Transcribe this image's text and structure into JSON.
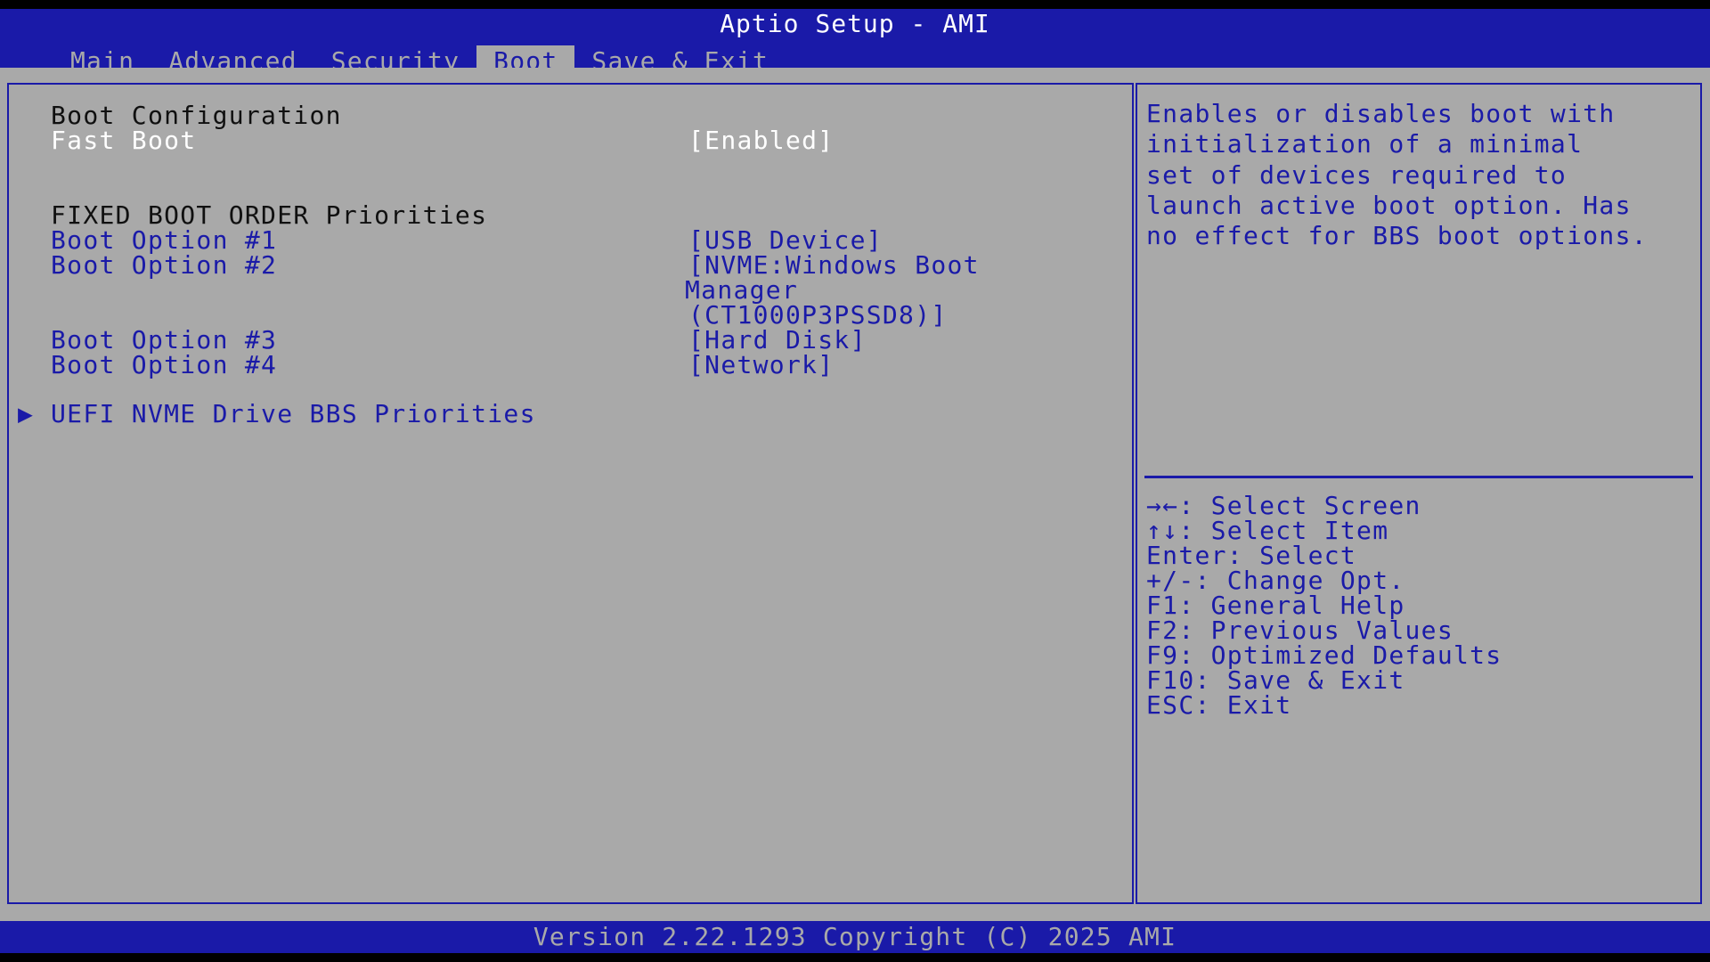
{
  "app": {
    "title": "Aptio Setup - AMI"
  },
  "tabs": [
    {
      "label": "Main"
    },
    {
      "label": "Advanced"
    },
    {
      "label": "Security"
    },
    {
      "label": "Boot",
      "active": true
    },
    {
      "label": "Save & Exit"
    }
  ],
  "boot": {
    "section_boot_config": "Boot Configuration",
    "fast_boot_label": "Fast Boot",
    "fast_boot_value": "[Enabled]",
    "section_fixed_order": "FIXED BOOT ORDER Priorities",
    "options": [
      {
        "label": "Boot Option #1",
        "value": "[USB Device]"
      },
      {
        "label": "Boot Option #2",
        "value_lines": [
          "[NVME:Windows Boot",
          "Manager",
          "(CT1000P3PSSD8)]"
        ]
      },
      {
        "label": "Boot Option #3",
        "value": "[Hard Disk]"
      },
      {
        "label": "Boot Option #4",
        "value": "[Network]"
      }
    ],
    "submenu_label": "UEFI NVME Drive BBS Priorities"
  },
  "help": {
    "description": "Enables or disables boot with\ninitialization of a minimal\nset of devices required to\nlaunch active boot option. Has\nno effect for BBS boot options.",
    "keys": [
      "→←: Select Screen",
      "↑↓: Select Item",
      "Enter: Select",
      "+/-: Change Opt.",
      "F1: General Help",
      "F2: Previous Values",
      "F9: Optimized Defaults",
      "F10: Save & Exit",
      "ESC: Exit"
    ]
  },
  "footer": {
    "version_text": "Version 2.22.1293 Copyright (C) 2025 AMI"
  },
  "colors": {
    "bios_blue": "#1a1aa8",
    "bios_gray": "#a9a9a9",
    "text_white": "#ffffff"
  }
}
